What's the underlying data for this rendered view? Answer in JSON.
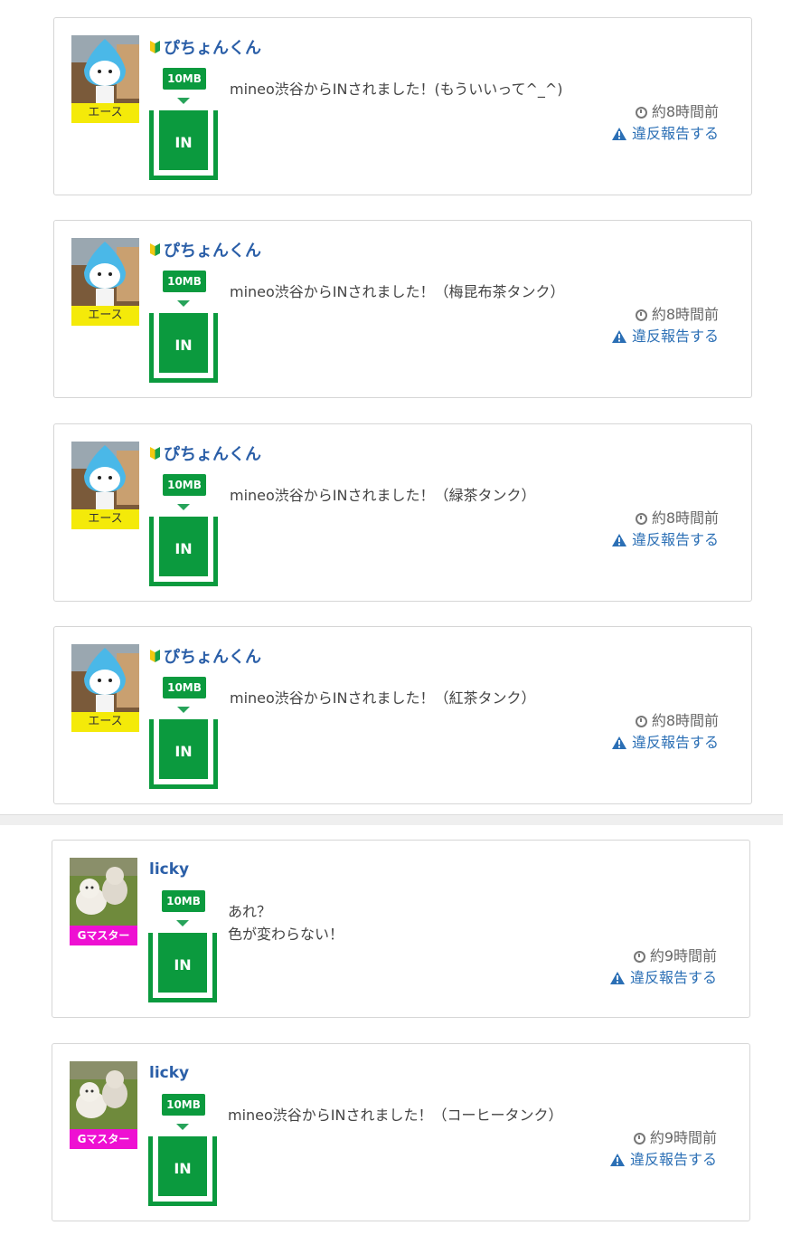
{
  "posts_upper": [
    {
      "username": "ぴちょんくん",
      "rank": "エース",
      "badge": "10MB",
      "status": "IN",
      "message": "mineo渋谷からINされました！(もういいって^_^)",
      "time": "約8時間前",
      "report": "違反報告する"
    },
    {
      "username": "ぴちょんくん",
      "rank": "エース",
      "badge": "10MB",
      "status": "IN",
      "message": "mineo渋谷からINされました！（梅昆布茶タンク）",
      "time": "約8時間前",
      "report": "違反報告する"
    },
    {
      "username": "ぴちょんくん",
      "rank": "エース",
      "badge": "10MB",
      "status": "IN",
      "message": "mineo渋谷からINされました！（緑茶タンク）",
      "time": "約8時間前",
      "report": "違反報告する"
    },
    {
      "username": "ぴちょんくん",
      "rank": "エース",
      "badge": "10MB",
      "status": "IN",
      "message": "mineo渋谷からINされました！（紅茶タンク）",
      "time": "約8時間前",
      "report": "違反報告する"
    }
  ],
  "posts_lower": [
    {
      "username": "licky",
      "rank": "Gマスター",
      "badge": "10MB",
      "status": "IN",
      "message": "あれ？\n色が変わらない！",
      "time": "約9時間前",
      "report": "違反報告する"
    },
    {
      "username": "licky",
      "rank": "Gマスター",
      "badge": "10MB",
      "status": "IN",
      "message": "mineo渋谷からINされました！（コーヒータンク）",
      "time": "約9時間前",
      "report": "違反報告する"
    }
  ],
  "colors": {
    "tank_green": "#0b9a3e",
    "ace_badge": "#f4ea09",
    "gmaster_badge": "#ee10d2",
    "link_blue": "#2b6fb5"
  },
  "icons": {
    "clock": "clock-icon",
    "warning": "warning-icon",
    "beginner": "beginner-mark-icon"
  }
}
